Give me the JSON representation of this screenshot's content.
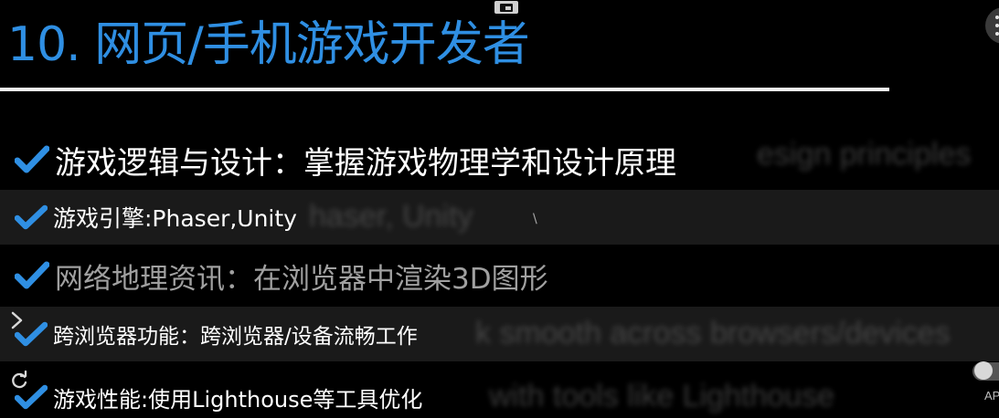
{
  "slide": {
    "title": "10. 网页/手机游戏开发者",
    "title_color": "#2f8fe3",
    "check_color": "#2f8fe3",
    "items": [
      {
        "text": "游戏逻辑与设计：掌握游戏物理学和设计原理",
        "ghost_text": "esign principles"
      },
      {
        "text": "游戏引擎:Phaser,Unity",
        "ghost_text": "haser, Unity"
      },
      {
        "text": "网络地理资讯：在浏览器中渲染3D图形",
        "ghost_text": ""
      },
      {
        "text": "跨浏览器功能：跨浏览器/设备流畅工作",
        "ghost_text": "k smooth across browsers/devices"
      },
      {
        "text": "游戏性能:使用Lighthouse等工具优化",
        "ghost_text": "with tools like Lighthouse"
      }
    ]
  },
  "overlay": {
    "corner_text": "AP",
    "stray_mark": "\\"
  },
  "icons": {
    "top": "picture-in-picture-icon",
    "corner": "more-options-icon",
    "expand": "chevron-right-icon",
    "refresh": "refresh-icon",
    "toggle": "toggle-switch",
    "check": "checkmark-icon"
  }
}
